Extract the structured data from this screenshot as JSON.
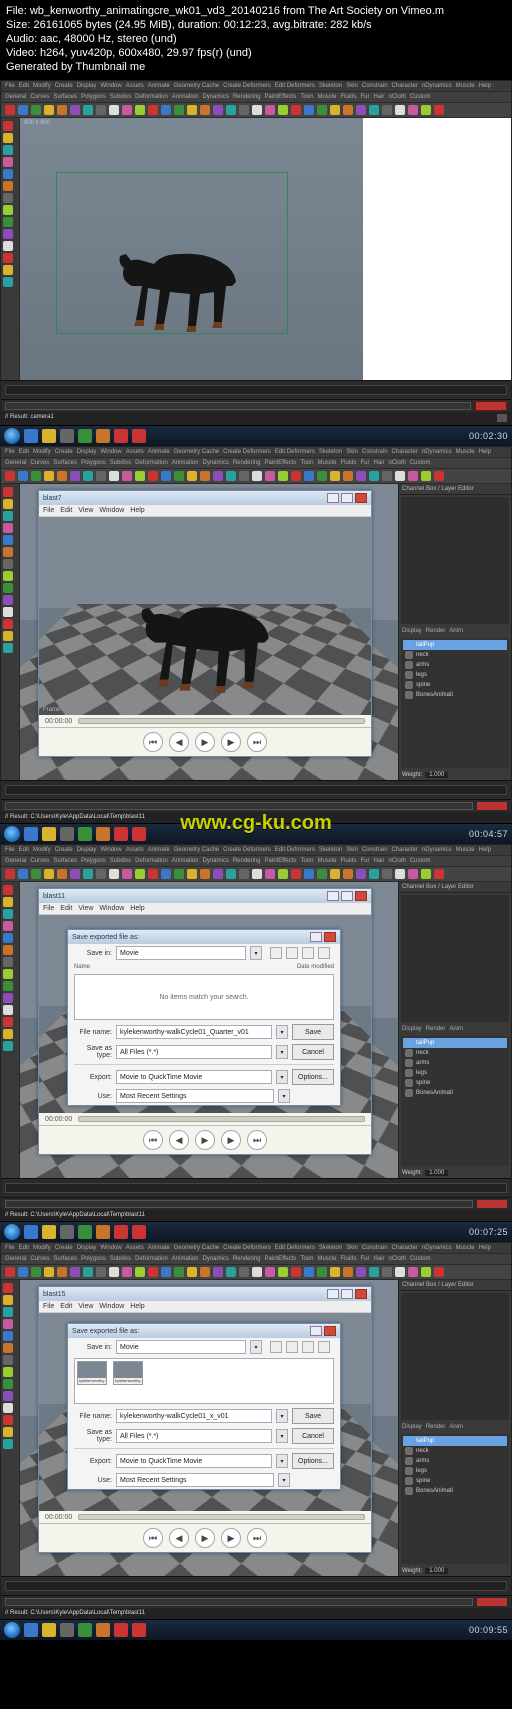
{
  "meta": {
    "line1": "File: wb_kenworthy_animatingcre_wk01_vd3_20140216 from The Art Society on Vimeo.m",
    "line2": "Size: 26161065 bytes (24.95 MiB), duration: 00:12:23, avg.bitrate: 282 kb/s",
    "line3": "Audio: aac, 48000 Hz, stereo (und)",
    "line4": "Video: h264, yuv420p, 600x480, 29.97 fps(r) (und)",
    "line5": "Generated by Thumbnail me"
  },
  "maya_menu": [
    "File",
    "Edit",
    "Modify",
    "Create",
    "Display",
    "Window",
    "Assets",
    "Animate",
    "Geometry Cache",
    "Create Deformers",
    "Edit Deformers",
    "Skeleton",
    "Skin",
    "Constrain",
    "Character",
    "nDynamics",
    "Muscle",
    "Help"
  ],
  "shelf_tabs": [
    "General",
    "Curves",
    "Surfaces",
    "Polygons",
    "Subdivs",
    "Deformation",
    "Animation",
    "Dynamics",
    "Rendering",
    "PaintEffects",
    "Toon",
    "Muscle",
    "Fluids",
    "Fur",
    "Hair",
    "nCloth",
    "Custom"
  ],
  "watermark": "www.cg-ku.com",
  "panel": {
    "title": "Channel Box / Layer Editor",
    "tabs": [
      "Display",
      "Render",
      "Anim"
    ],
    "layers": [
      {
        "name": "tailPup",
        "sw": "#68a4e6"
      },
      {
        "name": "neck",
        "sw": "#6d6d6d"
      },
      {
        "name": "arms",
        "sw": "#6d6d6d"
      },
      {
        "name": "legs",
        "sw": "#6d6d6d"
      },
      {
        "name": "spine",
        "sw": "#6d6d6d"
      },
      {
        "name": "BonesAnimati",
        "sw": "#6d6d6d"
      }
    ],
    "sel_index": 0,
    "weight_lbl": "Weight:",
    "weight_val": "1.000"
  },
  "cmdline": {
    "prompt": "// Result:  camera1",
    "path": "// Result:  C:\\Users\\Kyle\\AppData\\Local\\Temp\\blast11"
  },
  "viewport": {
    "res": "800 x 600",
    "framelbl": "Frame:"
  },
  "playblast": {
    "title": "blast7",
    "title2": "blast11",
    "title3": "blast15",
    "menu": [
      "File",
      "Edit",
      "View",
      "Window",
      "Help"
    ],
    "time": "00:00:00"
  },
  "save": {
    "title": "Save exported file as:",
    "savein_lbl": "Save in:",
    "savein_val": "Movie",
    "date_lbl": "Date modified",
    "name_lbl": "Name",
    "empty": "No items match your search.",
    "filename_lbl": "File name:",
    "filename_val": "kylekenworthy-walkCycle01_Quarter_v01",
    "filename2_val": "kylekenworthy-walkCycle01_x_v01",
    "saveas_lbl": "Save as type:",
    "saveas_val": "All Files (*.*)",
    "export_lbl": "Export:",
    "export_val": "Movie to QuickTime Movie",
    "use_lbl": "Use:",
    "use_val": "Most Recent Settings",
    "btn_save": "Save",
    "btn_cancel": "Cancel",
    "btn_options": "Options...",
    "thumb1": "kylekenworthy-w...",
    "thumb2": "kylekenworthy-w..."
  },
  "clocks": [
    "00:02:30",
    "00:04:57",
    "00:07:25",
    "00:09:55"
  ],
  "playctrl": {
    "back": "⏮",
    "prev": "◀",
    "play": "▶",
    "next": "▶",
    "end": "⏭"
  }
}
